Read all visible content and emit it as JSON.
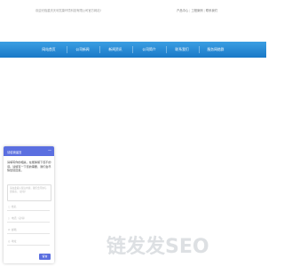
{
  "topbar": {
    "notice": "欢迎光临重庆天利富康环境科技有限公司官方网站!",
    "links": [
      "产品中心",
      "工程案例",
      "联系我们"
    ],
    "sep": "|"
  },
  "nav": {
    "items": [
      "网站首页",
      "公司新闻",
      "新闻资讯",
      "公司简介",
      "联系我们",
      "服务网络群"
    ]
  },
  "chat": {
    "title": "请给我留言",
    "minimize": "—",
    "message": "请填写你的相关，在能够留下您不的话。请填写一下您的需要，我们会尽快给您回复。",
    "textarea_placeholder": "请在此输入留言内容，我们会尽快与您联系。（必填）",
    "fields": [
      {
        "icon": "user",
        "placeholder": "姓名"
      },
      {
        "icon": "phone",
        "placeholder": "电话（必填）"
      },
      {
        "icon": "email",
        "placeholder": "邮箱"
      },
      {
        "icon": "location",
        "placeholder": "地址"
      }
    ],
    "send_label": "留言"
  },
  "watermark": "链发发SEO",
  "colors": {
    "nav": "#1a79c7",
    "chat_accent": "#5b6fe0",
    "watermark": "#dde0e3"
  }
}
